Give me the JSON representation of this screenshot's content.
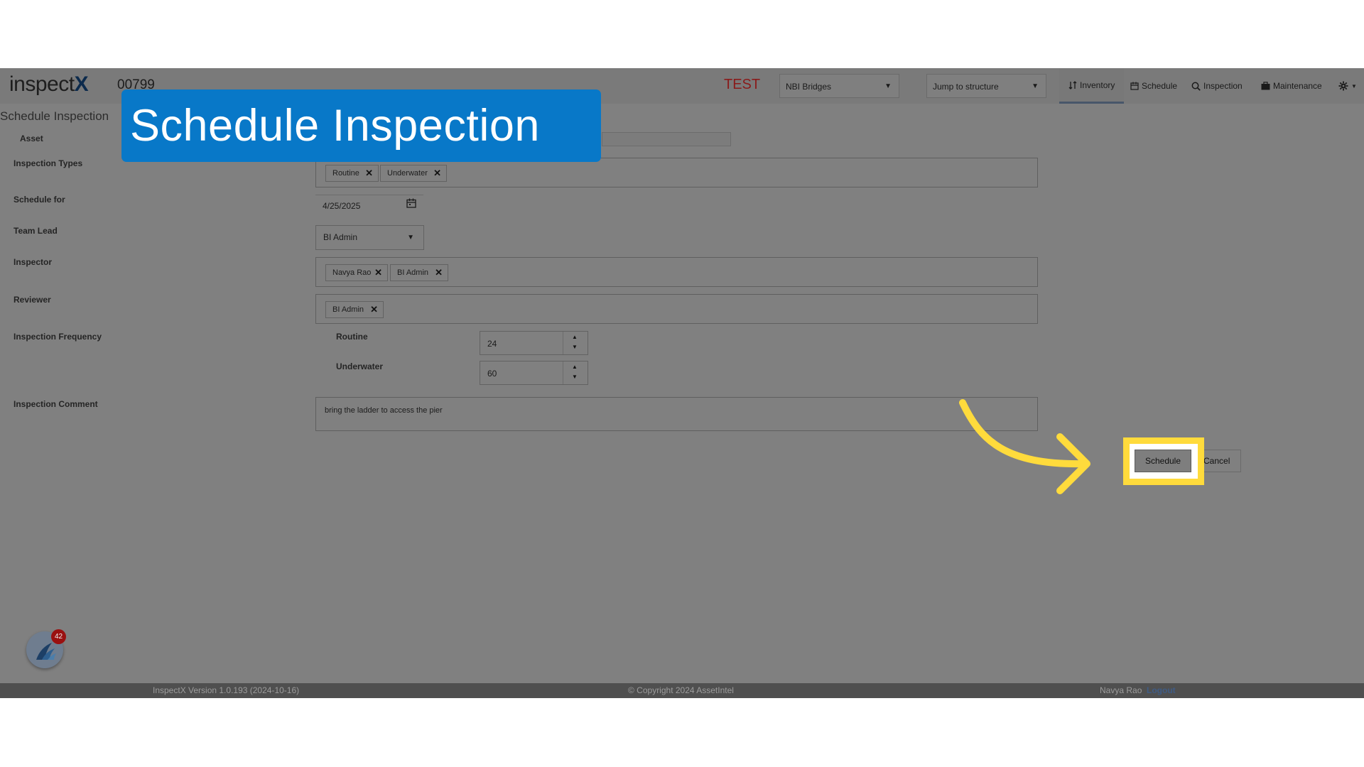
{
  "header": {
    "logo_text": "inspect",
    "logo_x": "X",
    "asset_number": "00799",
    "environment": "TEST",
    "inventory_select": "NBI Bridges",
    "jump_select": "Jump to structure",
    "nav": [
      {
        "label": "Inventory",
        "icon": "sort-icon"
      },
      {
        "label": "Schedule",
        "icon": "calendar-icon"
      },
      {
        "label": "Inspection",
        "icon": "search-icon"
      },
      {
        "label": "Maintenance",
        "icon": "briefcase-icon"
      }
    ],
    "settings_icon": "gear-icon"
  },
  "page": {
    "title": "Schedule Inspection",
    "labels": {
      "asset": "Asset",
      "inspection_types": "Inspection Types",
      "schedule_for": "Schedule for",
      "team_lead": "Team Lead",
      "inspector": "Inspector",
      "reviewer": "Reviewer",
      "inspection_frequency": "Inspection Frequency",
      "inspection_comment": "Inspection Comment"
    },
    "inspection_types": [
      "Routine",
      "Underwater"
    ],
    "schedule_for": "4/25/2025",
    "team_lead": "BI Admin",
    "inspectors": [
      "Navya Rao",
      "BI Admin"
    ],
    "reviewers": [
      "BI Admin"
    ],
    "frequency": [
      {
        "label": "Routine",
        "value": "24"
      },
      {
        "label": "Underwater",
        "value": "60"
      }
    ],
    "comment": "bring the ladder to access the pier",
    "buttons": {
      "schedule": "Schedule",
      "cancel": "Cancel"
    }
  },
  "notification_count": "42",
  "footer": {
    "version": "InspectX Version 1.0.193 (2024-10-16)",
    "copyright": "© Copyright 2024 AssetIntel",
    "user": "Navya Rao",
    "logout": "Logout"
  },
  "overlay": {
    "title": "Schedule Inspection",
    "title_bg": "#0878C8",
    "highlight_color": "#FFDB3C"
  }
}
